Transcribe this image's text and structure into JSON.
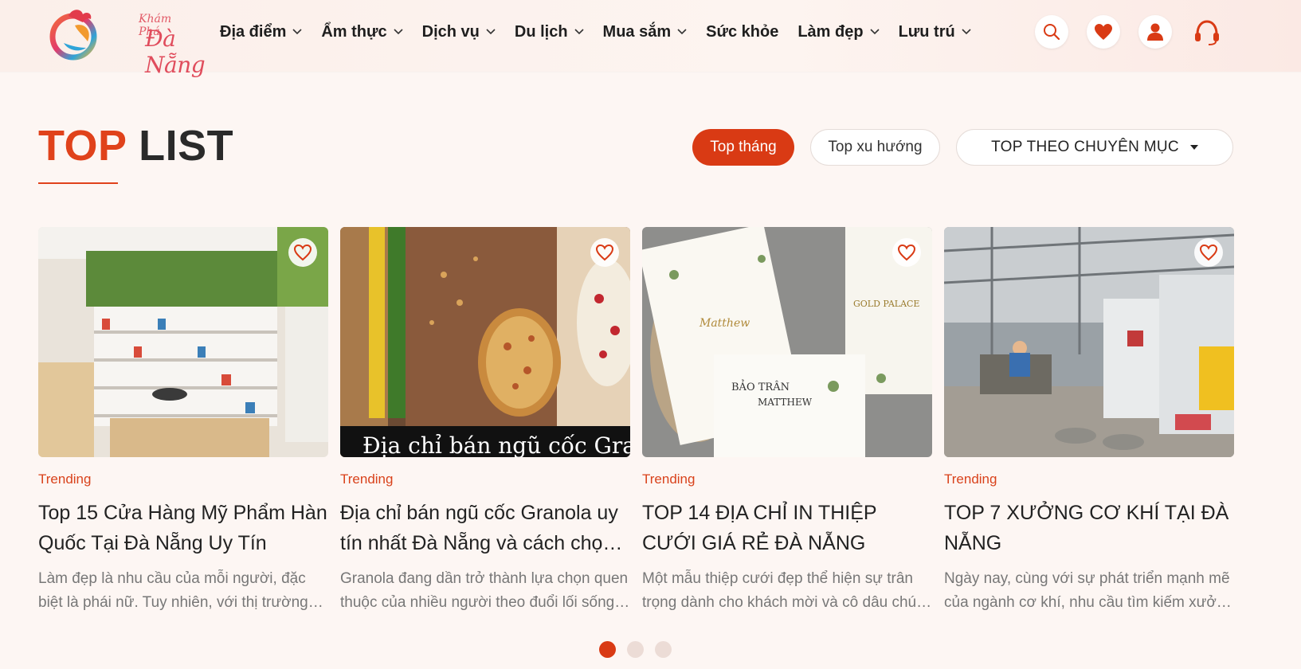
{
  "logo": {
    "line1": "Khám Phá",
    "line2": "Đà Nẵng"
  },
  "nav": [
    {
      "label": "Địa điểm",
      "dropdown": true
    },
    {
      "label": "Ẩm thực",
      "dropdown": true
    },
    {
      "label": "Dịch vụ",
      "dropdown": true
    },
    {
      "label": "Du lịch",
      "dropdown": true
    },
    {
      "label": "Mua sắm",
      "dropdown": true
    },
    {
      "label": "Sức khỏe",
      "dropdown": false
    },
    {
      "label": "Làm đẹp",
      "dropdown": true
    },
    {
      "label": "Lưu trú",
      "dropdown": true
    }
  ],
  "header_icons": [
    "search-icon",
    "heart-icon",
    "user-icon",
    "headset-icon"
  ],
  "section": {
    "title_accent": "TOP",
    "title_rest": "LIST"
  },
  "filters": {
    "active": "Top tháng",
    "trending": "Top xu hướng",
    "category": "TOP THEO CHUYÊN MỤC"
  },
  "cards": [
    {
      "tag": "Trending",
      "title": "Top 15 Cửa Hàng Mỹ Phẩm Hàn Quốc Tại Đà Nẵng Uy Tín",
      "desc": "Làm đẹp là nhu cầu của mỗi người, đặc biệt là phái nữ. Tuy nhiên, với thị trường mỹ phẩm đa dạng",
      "image": "cosmetics-store-photo"
    },
    {
      "tag": "Trending",
      "title": "Địa chỉ bán ngũ cốc Granola uy tín nhất Đà Nẵng và cách chọn mua",
      "desc": "Granola đang dần trở thành lựa chọn quen thuộc của nhiều người theo đuổi lối sống lành mạnh",
      "image": "granola-photo"
    },
    {
      "tag": "Trending",
      "title": "TOP 14 ĐỊA CHỈ IN THIỆP CƯỚI GIÁ RẺ ĐÀ NẴNG",
      "desc": "Một mẫu thiệp cưới đẹp thể hiện sự trân trọng dành cho khách mời và cô dâu chú rể",
      "image": "wedding-invitation-photo"
    },
    {
      "tag": "Trending",
      "title": "TOP 7 XƯỞNG CƠ KHÍ TẠI ĐÀ NẴNG",
      "desc": "Ngày nay, cùng với sự phát triển mạnh mẽ của ngành cơ khí, nhu cầu tìm kiếm xưởng uy tín",
      "image": "machine-workshop-photo"
    }
  ],
  "pagination": {
    "pages": 3,
    "current": 1
  },
  "colors": {
    "accent": "#d93a14",
    "title_accent": "#e0421b"
  }
}
